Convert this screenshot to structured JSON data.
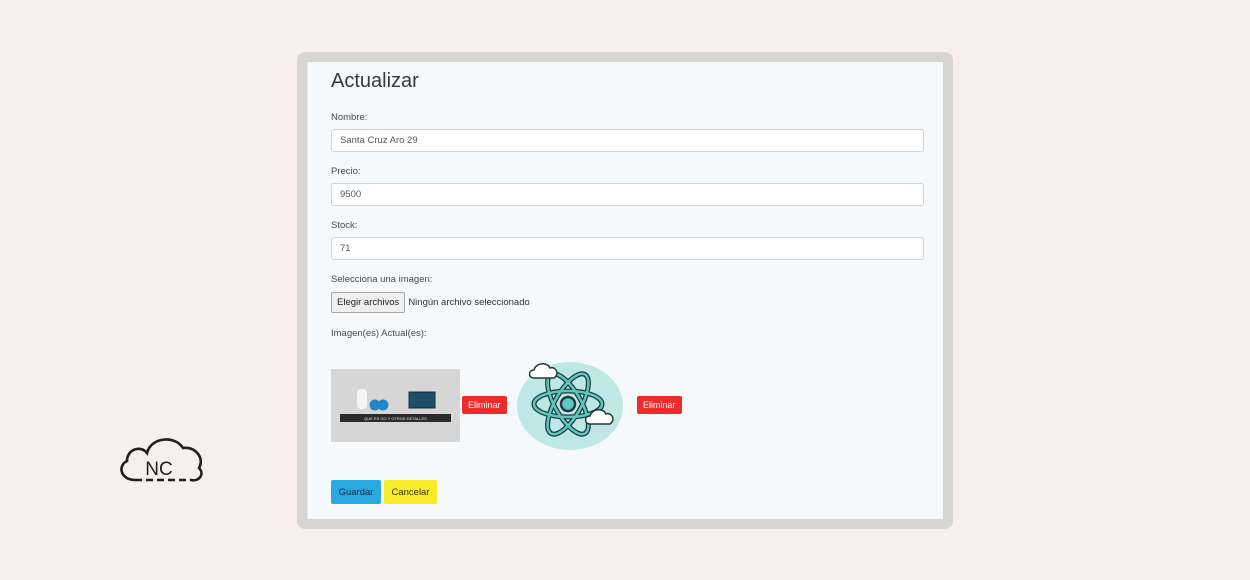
{
  "logo": {
    "text": "NC"
  },
  "form": {
    "title": "Actualizar",
    "name_label": "Nombre:",
    "name_value": "Santa Cruz Aro 29",
    "price_label": "Precio:",
    "price_value": "9500",
    "stock_label": "Stock:",
    "stock_value": "71",
    "image_select_label": "Selecciona una imagen:",
    "file_button_label": "Elegir archivos",
    "file_status": "Ningún archivo seleccionado",
    "current_images_label": "Imagen(es) Actual(es):",
    "images": [
      {
        "delete_label": "Eliminar",
        "caption": "QUE ES GO Y OTROS DETALLES"
      },
      {
        "delete_label": "Eliminar"
      }
    ],
    "save_label": "Guardar",
    "cancel_label": "Cancelar"
  },
  "colors": {
    "page_bg": "#f7efed",
    "save": "#29a9e0",
    "cancel": "#f8ec2a",
    "delete": "#ef2b2b"
  }
}
